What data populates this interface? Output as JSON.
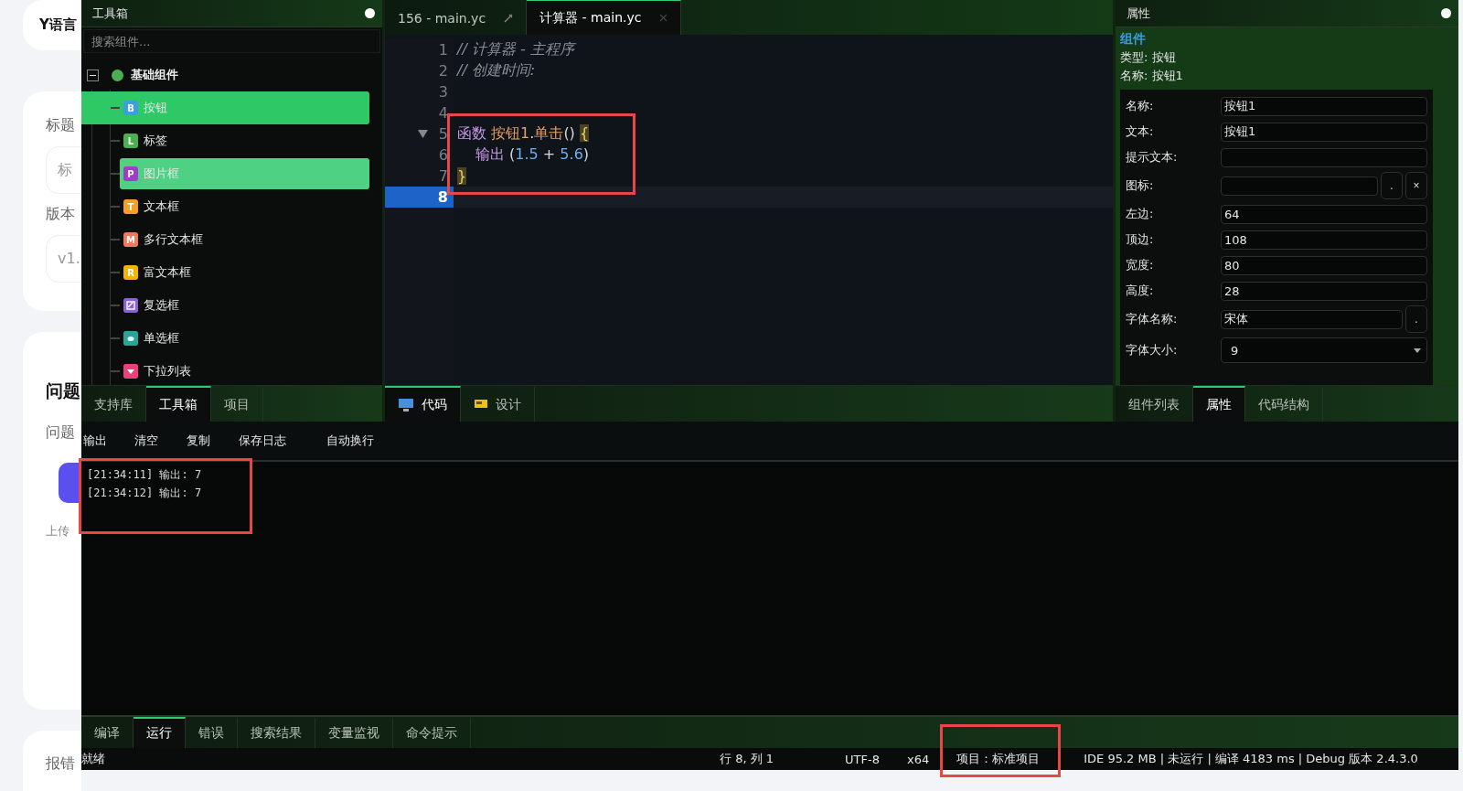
{
  "background_page": {
    "cards": [
      {
        "items": [
          {
            "kind": "title",
            "text": "Y语言"
          }
        ]
      },
      {
        "items": [
          {
            "kind": "label",
            "text": "标题"
          },
          {
            "kind": "input",
            "text": "标"
          },
          {
            "kind": "label",
            "text": "版本"
          },
          {
            "kind": "input",
            "text": "v1."
          }
        ]
      },
      {
        "items": [
          {
            "kind": "heading",
            "text": "问题"
          },
          {
            "kind": "label",
            "text": "问题"
          },
          {
            "kind": "button"
          },
          {
            "kind": "note",
            "text": "上传"
          }
        ]
      },
      {
        "items": [
          {
            "kind": "label",
            "text": "报错"
          }
        ]
      }
    ]
  },
  "toolbox": {
    "title": "工具箱",
    "search": {
      "placeholder": "搜索组件..."
    },
    "tree": {
      "label": "基础组件",
      "expanded": true,
      "children": [
        {
          "kind": "letter",
          "badge": "B",
          "label": "按钮",
          "color": "#3aa0d8",
          "selected": true,
          "hovered": false
        },
        {
          "kind": "letter",
          "badge": "L",
          "label": "标签",
          "color": "#4caf50",
          "selected": false,
          "hovered": false
        },
        {
          "kind": "letter",
          "badge": "P",
          "label": "图片框",
          "color": "#9c3fc4",
          "selected": false,
          "hovered": true
        },
        {
          "kind": "letter",
          "badge": "T",
          "label": "文本框",
          "color": "#f5a023",
          "selected": false,
          "hovered": false
        },
        {
          "kind": "letter",
          "badge": "M",
          "label": "多行文本框",
          "color": "#ee7a5a",
          "selected": false,
          "hovered": false
        },
        {
          "kind": "letter",
          "badge": "R",
          "label": "富文本框",
          "color": "#f4b400",
          "selected": false,
          "hovered": false
        },
        {
          "kind": "checkbox",
          "label": "复选框",
          "color": "#8a63d2",
          "selected": false,
          "hovered": false
        },
        {
          "kind": "radio",
          "label": "单选框",
          "color": "#26a69a",
          "selected": false,
          "hovered": false
        },
        {
          "kind": "dropdown",
          "label": "下拉列表",
          "color": "#ec407a",
          "selected": false,
          "hovered": false
        }
      ]
    },
    "tabs": [
      {
        "label": "支持库",
        "selected": false
      },
      {
        "label": "工具箱",
        "selected": true
      },
      {
        "label": "项目",
        "selected": false
      }
    ]
  },
  "editor": {
    "tabs": [
      {
        "label": "156 - main.yc",
        "selected": false
      },
      {
        "label": "计算器 - main.yc",
        "selected": true
      }
    ],
    "lines": [
      {
        "number": "1",
        "current": false,
        "foldable": false,
        "tokens": [
          {
            "kind": "comment",
            "text": "// 计算器 - 主程序"
          }
        ]
      },
      {
        "number": "2",
        "current": false,
        "foldable": false,
        "tokens": [
          {
            "kind": "comment",
            "text": "// 创建时间:"
          }
        ]
      },
      {
        "number": "3",
        "current": false,
        "foldable": false
      },
      {
        "number": "4",
        "current": false,
        "foldable": false
      },
      {
        "number": "5",
        "current": false,
        "foldable": true,
        "tokens": [
          {
            "kind": "keyword",
            "text": "函数 "
          },
          {
            "kind": "name",
            "text": "按钮1"
          },
          {
            "kind": "plain",
            "text": "."
          },
          {
            "kind": "name",
            "text": "单击"
          },
          {
            "kind": "plain",
            "text": "() "
          },
          {
            "kind": "brace",
            "text": "{"
          }
        ]
      },
      {
        "number": "6",
        "current": false,
        "foldable": false,
        "indented": true,
        "tokens": [
          {
            "kind": "keyword",
            "text": "输出"
          },
          {
            "kind": "plain",
            "text": " ("
          },
          {
            "kind": "number",
            "text": "1.5"
          },
          {
            "kind": "plain",
            "text": " + "
          },
          {
            "kind": "number",
            "text": "5.6"
          },
          {
            "kind": "plain",
            "text": ")"
          }
        ]
      },
      {
        "number": "7",
        "current": false,
        "foldable": false,
        "tokens": [
          {
            "kind": "brace",
            "text": "}"
          }
        ]
      },
      {
        "number": "8",
        "current": true,
        "foldable": false
      }
    ],
    "view_tabs": [
      {
        "label": "代码",
        "kind": "code",
        "selected": true
      },
      {
        "label": "设计",
        "kind": "design",
        "selected": false
      }
    ]
  },
  "properties": {
    "title": "属性",
    "section": "组件",
    "type_line": "类型: 按钮",
    "name_line": "名称: 按钮1",
    "rows": [
      {
        "kind": "text",
        "label": "名称:",
        "value": "按钮1"
      },
      {
        "kind": "text",
        "label": "文本:",
        "value": "按钮1"
      },
      {
        "kind": "text",
        "label": "提示文本:"
      },
      {
        "kind": "file",
        "label": "图标:",
        "buttons": [
          ".",
          "×"
        ]
      },
      {
        "kind": "text",
        "label": "左边:",
        "value": "64"
      },
      {
        "kind": "text",
        "label": "顶边:",
        "value": "108"
      },
      {
        "kind": "text",
        "label": "宽度:",
        "value": "80"
      },
      {
        "kind": "text",
        "label": "高度:",
        "value": "28"
      },
      {
        "kind": "file",
        "label": "字体名称:",
        "value": "宋体",
        "buttons": [
          "."
        ]
      },
      {
        "kind": "select",
        "label": "字体大小:",
        "value": "9"
      }
    ],
    "tabs": [
      {
        "label": "组件列表",
        "selected": false
      },
      {
        "label": "属性",
        "selected": true
      },
      {
        "label": "代码结构",
        "selected": false
      }
    ]
  },
  "output": {
    "toolbar": [
      "输出",
      "清空",
      "复制",
      "保存日志",
      "自动换行"
    ],
    "lines": [
      "[21:34:11] 输出: 7",
      "[21:34:12] 输出: 7"
    ]
  },
  "bottom_tabs": [
    {
      "label": "编译",
      "selected": false
    },
    {
      "label": "运行",
      "selected": true
    },
    {
      "label": "错误",
      "selected": false
    },
    {
      "label": "搜索结果",
      "selected": false
    },
    {
      "label": "变量监视",
      "selected": false
    },
    {
      "label": "命令提示",
      "selected": false
    }
  ],
  "status_bar": {
    "message": "就绪",
    "position": "行 8, 列 1",
    "encoding": "UTF-8",
    "arch": "x64",
    "project": "项目：标准项目",
    "info": "IDE 95.2 MB | 未运行 | 编译 4183 ms | Debug  版本 2.4.3.0"
  }
}
